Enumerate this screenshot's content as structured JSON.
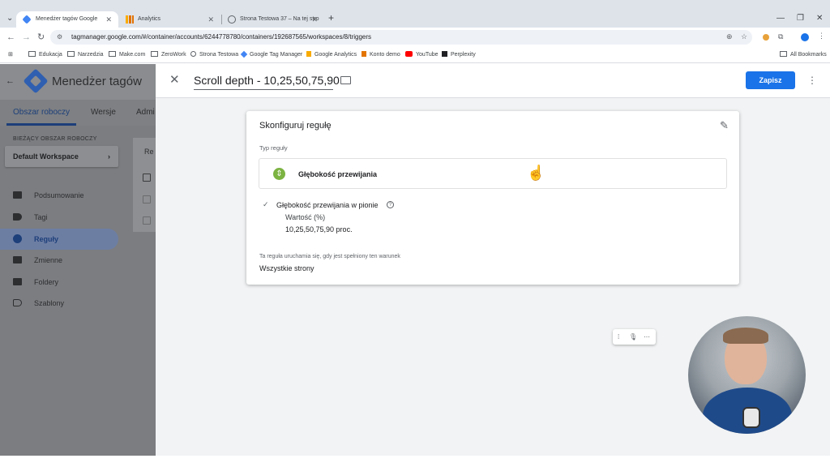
{
  "browser": {
    "tabs": [
      {
        "title": "Menedżer tagów Google",
        "active": true
      },
      {
        "title": "Analytics",
        "active": false
      },
      {
        "title": "Strona Testowa 37 – Na tej stro",
        "active": false
      }
    ],
    "url": "tagmanager.google.com/#/container/accounts/6244778780/containers/192687565/workspaces/8/triggers",
    "bookmarks": [
      "Edukacja",
      "Narzedzia",
      "Make.com",
      "ZeroWork",
      "Strona Testowa",
      "Google Tag Manager",
      "Google Analytics",
      "Konto demo",
      "YouTube",
      "Perplexity"
    ],
    "all_bookmarks": "All Bookmarks"
  },
  "gtm": {
    "app_title": "Menedżer tagów",
    "nav_tabs": [
      "Obszar roboczy",
      "Wersje",
      "Admi"
    ],
    "workspace_label": "BIEŻĄCY OBSZAR ROBOCZY",
    "workspace_name": "Default Workspace",
    "sidebar_items": [
      "Podsumowanie",
      "Tagi",
      "Reguły",
      "Zmienne",
      "Foldery",
      "Szablony"
    ],
    "active_sidebar": "Reguły",
    "panel_partial": "Re"
  },
  "editor": {
    "trigger_name": "Scroll depth - 10,25,50,75,90",
    "save_label": "Zapisz",
    "card_title": "Skonfiguruj regułę",
    "type_label": "Typ reguły",
    "type_name": "Głębokość przewijania",
    "vertical_label": "Głębokość przewijania w pionie",
    "value_label": "Wartość (%)",
    "value_text": "10,25,50,75,90  proc.",
    "condition_label": "Ta reguła uruchamia się, gdy jest spełniony ten warunek",
    "condition_value": "Wszystkie strony"
  },
  "colors": {
    "primary": "#1a73e8",
    "scroll_icon": "#7cb342"
  },
  "icons": {
    "close": "✕",
    "more": "⋮",
    "pencil": "✎",
    "check": "✓",
    "help": "?",
    "cursor": "☝",
    "chevron": "›",
    "back": "←"
  }
}
